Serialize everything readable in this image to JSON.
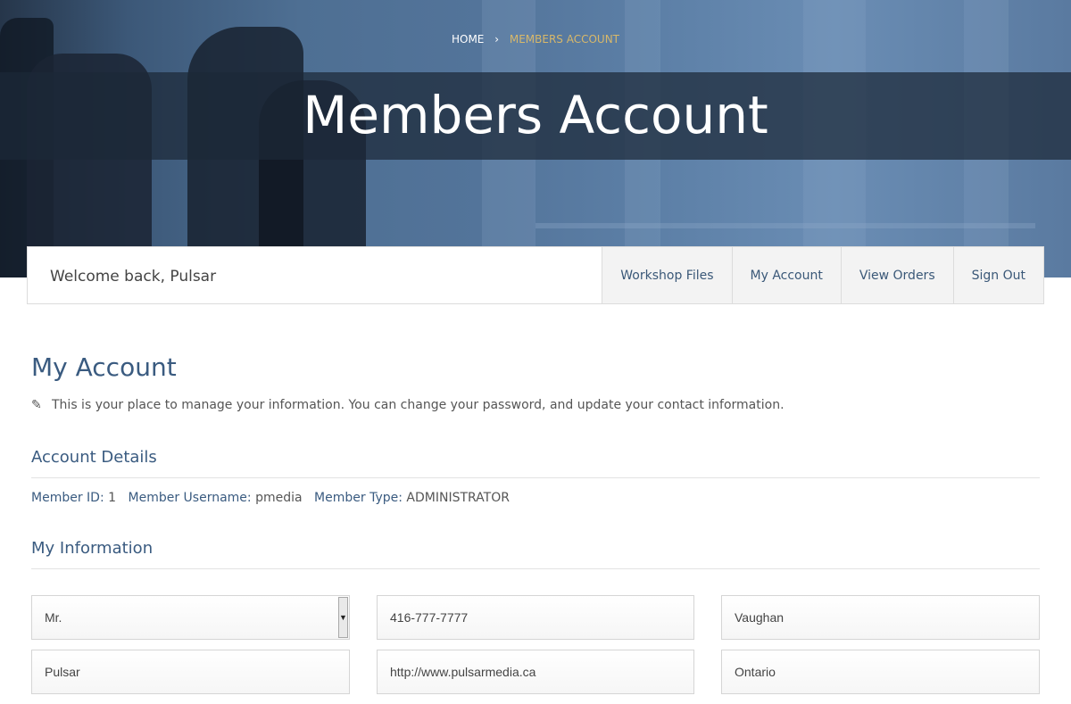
{
  "breadcrumb": {
    "home": "HOME",
    "separator": "›",
    "current": "MEMBERS ACCOUNT"
  },
  "hero": {
    "title": "Members Account"
  },
  "member_bar": {
    "welcome": "Welcome back, Pulsar",
    "nav": [
      {
        "label": "Workshop Files"
      },
      {
        "label": "My Account"
      },
      {
        "label": "View Orders"
      },
      {
        "label": "Sign Out"
      }
    ]
  },
  "main": {
    "heading": "My Account",
    "intro_icon": "pencil-icon",
    "intro": "This is your place to manage your information. You can change your password, and update your contact information.",
    "account_details": {
      "heading": "Account Details",
      "member_id_label": "Member ID:",
      "member_id": "1",
      "username_label": "Member Username:",
      "username": "pmedia",
      "type_label": "Member Type:",
      "type": "ADMINISTRATOR"
    },
    "my_information": {
      "heading": "My Information",
      "fields": {
        "salutation": "Mr.",
        "phone": "416-777-7777",
        "city": "Vaughan",
        "first_name": "Pulsar",
        "website": "http://www.pulsarmedia.ca",
        "province": "Ontario"
      }
    }
  },
  "colors": {
    "accent": "#3a5b80",
    "breadcrumb_current": "#d8b86a",
    "hero_band": "#1c2838"
  }
}
